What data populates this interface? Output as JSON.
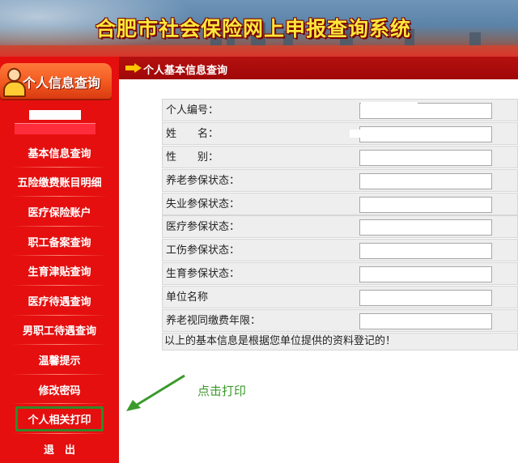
{
  "banner": {
    "title": "合肥市社会保险网上申报查询系统"
  },
  "sidebar": {
    "header_label": "个人信息查询",
    "items": [
      {
        "label": "基本信息查询"
      },
      {
        "label": "五险缴费账目明细"
      },
      {
        "label": "医疗保险账户"
      },
      {
        "label": "职工备案查询"
      },
      {
        "label": "生育津贴查询"
      },
      {
        "label": "医疗待遇查询"
      },
      {
        "label": "男职工待遇查询"
      },
      {
        "label": "温馨提示"
      },
      {
        "label": "修改密码"
      },
      {
        "label": "个人相关打印"
      },
      {
        "label": "退　出"
      }
    ]
  },
  "main": {
    "section_title": "个人基本信息查询",
    "rows": [
      {
        "label": "个人编号：",
        "value": ""
      },
      {
        "label": "姓　　名：",
        "value": ""
      },
      {
        "label": "性　　别：",
        "value": ""
      },
      {
        "label": "养老参保状态：",
        "value": ""
      },
      {
        "label": "失业参保状态：",
        "value": ""
      },
      {
        "label": "医疗参保状态：",
        "value": ""
      },
      {
        "label": "工伤参保状态：",
        "value": ""
      },
      {
        "label": "生育参保状态：",
        "value": ""
      },
      {
        "label": "单位名称",
        "value": ""
      },
      {
        "label": "养老视同缴费年限：",
        "value": ""
      }
    ],
    "note": "以上的基本信息是根据您单位提供的资料登记的！"
  },
  "annotation": {
    "text": "点击打印",
    "color": "#3a9a2a"
  },
  "colors": {
    "sidebar_red": "#e50f0f",
    "title_yellow": "#fde73a",
    "highlight_green": "#2f8a2a"
  }
}
